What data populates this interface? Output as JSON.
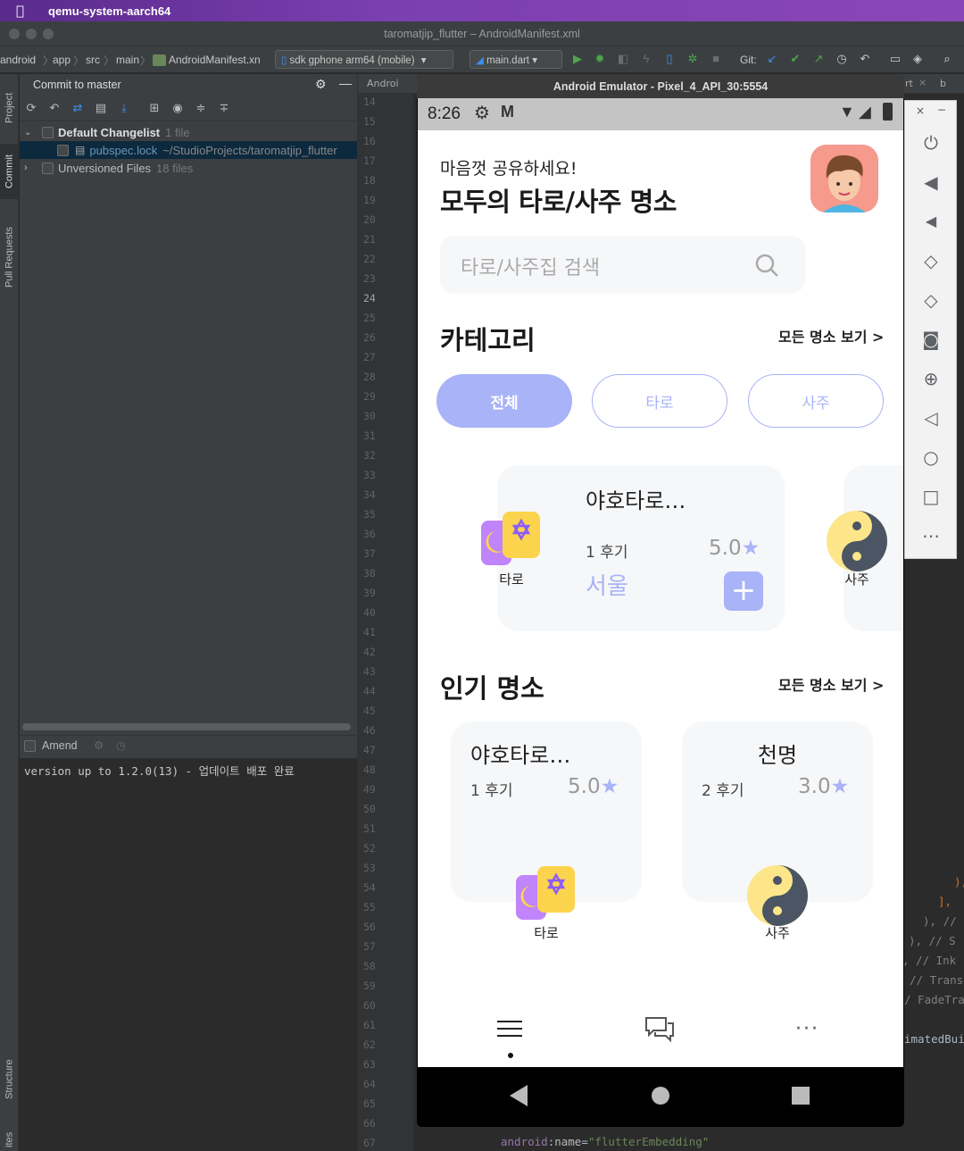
{
  "menubar": {
    "app": "qemu-system-aarch64"
  },
  "window": {
    "title": "taromatjip_flutter – AndroidManifest.xml"
  },
  "toolbar": {
    "crumbs": [
      "android",
      "app",
      "src",
      "main"
    ],
    "file": "AndroidManifest.xn",
    "device": "sdk gphone arm64 (mobile)",
    "run_config": "main.dart",
    "git_label": "Git:"
  },
  "left_stripe": {
    "project": "Project",
    "commit": "Commit",
    "pull_requests": "Pull Requests",
    "structure": "Structure",
    "favorites": "ites"
  },
  "commit_panel": {
    "title": "Commit to master",
    "changelist": {
      "name": "Default Changelist",
      "count": "1 file"
    },
    "file": {
      "name": "pubspec.lock",
      "path": "~/StudioProjects/taromatjip_flutter"
    },
    "unversioned": {
      "name": "Unversioned Files",
      "count": "18 files"
    },
    "amend": "Amend",
    "message": "version up to 1.2.0(13) - 업데이트 배포 완료"
  },
  "editor": {
    "tabs": [
      "Androi",
      "rt",
      "b"
    ],
    "line_numbers": [
      "14",
      "15",
      "16",
      "17",
      "18",
      "19",
      "20",
      "21",
      "22",
      "23",
      "24",
      "25",
      "26",
      "27",
      "28",
      "29",
      "30",
      "31",
      "32",
      "33",
      "34",
      "35",
      "36",
      "37",
      "38",
      "39",
      "40",
      "41",
      "42",
      "43",
      "44",
      "45",
      "46",
      "47",
      "48",
      "49",
      "50",
      "51",
      "52",
      "53",
      "54",
      "55",
      "56",
      "57",
      "58",
      "59",
      "60",
      "61",
      "62",
      "63",
      "64",
      "65",
      "66",
      "67"
    ],
    "current_line": "24",
    "code_fragments": [
      "),",
      "],",
      "),  //",
      "),  // S",
      ",  // Ink",
      "// Trans",
      "/ FadeTra",
      "imatedBui"
    ],
    "bottom_line": {
      "attr": "android",
      "colon": ":",
      "name": "name",
      "eq": "=",
      "value": "\"flutterEmbedding\""
    }
  },
  "emulator": {
    "title": "Android Emulator - Pixel_4_API_30:5554",
    "status_time": "8:26",
    "app": {
      "greeting": "마음껏 공유하세요!",
      "headline": "모두의 타로/사주 명소",
      "search_placeholder": "타로/사주집 검색",
      "category_title": "카테고리",
      "see_all": "모든 명소 보기 >",
      "categories": [
        {
          "label": "전체",
          "selected": true
        },
        {
          "label": "타로",
          "selected": false
        },
        {
          "label": "사주",
          "selected": false
        }
      ],
      "category_card": {
        "title": "야호타로…",
        "reviews": "1 후기",
        "rating": "5.0",
        "location": "서울",
        "icon_label": "타로"
      },
      "category_card_next_label": "사주",
      "popular_title": "인기 명소",
      "popular_see_all": "모든 명소 보기 >",
      "popular": [
        {
          "title": "야호타로…",
          "reviews": "1 후기",
          "rating": "5.0",
          "icon_label": "타로"
        },
        {
          "title": "천명",
          "reviews": "2 후기",
          "rating": "3.0",
          "icon_label": "사주"
        }
      ]
    }
  },
  "colors": {
    "accent": "#a9b3f7",
    "ide_bg": "#2b2b2b",
    "panel_bg": "#3c3f41",
    "menubar": "#7b3fb0"
  }
}
